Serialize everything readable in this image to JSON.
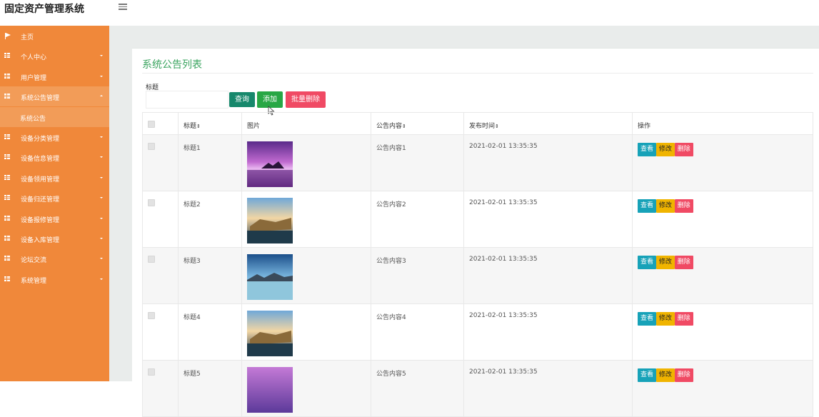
{
  "app": {
    "title": "固定资产管理系统"
  },
  "sidebar": {
    "items": [
      {
        "label": "主页",
        "icon": "flag-icon"
      },
      {
        "label": "个人中心",
        "icon": "grid-icon"
      },
      {
        "label": "用户管理",
        "icon": "grid-icon"
      },
      {
        "label": "系统公告管理",
        "icon": "grid-icon",
        "open": true
      },
      {
        "label": "设备分类管理",
        "icon": "grid-icon"
      },
      {
        "label": "设备信息管理",
        "icon": "grid-icon"
      },
      {
        "label": "设备领用管理",
        "icon": "grid-icon"
      },
      {
        "label": "设备归还管理",
        "icon": "grid-icon"
      },
      {
        "label": "设备报修管理",
        "icon": "grid-icon"
      },
      {
        "label": "设备入库管理",
        "icon": "grid-icon"
      },
      {
        "label": "论坛交流",
        "icon": "grid-icon"
      },
      {
        "label": "系统管理",
        "icon": "grid-icon"
      }
    ],
    "sub_item": {
      "label": "系统公告"
    },
    "color": "#f0883a"
  },
  "page": {
    "title": "系统公告列表",
    "search_label": "标题",
    "search_value": "",
    "search_placeholder": "",
    "buttons": {
      "query": "查询",
      "add": "添加",
      "batch_delete": "批量删除"
    }
  },
  "table": {
    "columns": [
      "标题",
      "图片",
      "公告内容",
      "发布时间",
      "操作"
    ],
    "sortable": [
      true,
      false,
      true,
      true,
      false
    ],
    "rows": [
      {
        "title": "标题1",
        "content": "公告内容1",
        "time": "2021-02-01 13:35:35",
        "image": "purple-sunset-island"
      },
      {
        "title": "标题2",
        "content": "公告内容2",
        "time": "2021-02-01 13:35:35",
        "image": "harbor-town-dusk"
      },
      {
        "title": "标题3",
        "content": "公告内容3",
        "time": "2021-02-01 13:35:35",
        "image": "lake-mountain-reflection"
      },
      {
        "title": "标题4",
        "content": "公告内容4",
        "time": "2021-02-01 13:35:35",
        "image": "harbor-town-dusk"
      },
      {
        "title": "标题5",
        "content": "公告内容5",
        "time": "2021-02-01 13:35:35",
        "image": "purple-sky"
      }
    ],
    "row_actions": {
      "view": "查看",
      "edit": "修改",
      "delete": "删除"
    }
  },
  "colors": {
    "accent_green": "#3aa45f",
    "view": "#17a2b8",
    "edit": "#f0b400",
    "delete": "#f04a64"
  }
}
